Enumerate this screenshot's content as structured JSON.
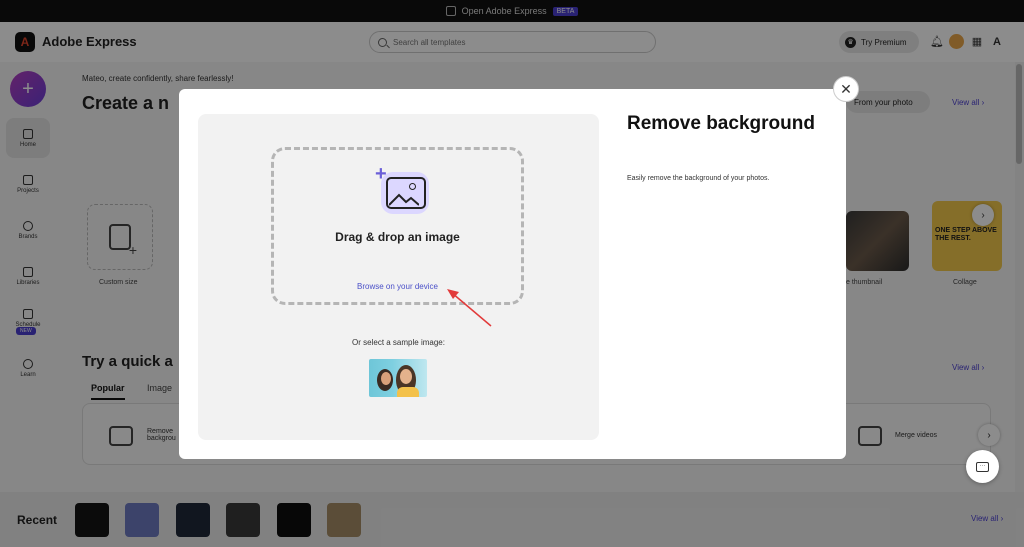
{
  "topbar": {
    "label": "Open Adobe Express",
    "badge": "BETA"
  },
  "header": {
    "app_name": "Adobe Express",
    "search_placeholder": "Search all templates",
    "premium_label": "Try Premium"
  },
  "rail": {
    "items": [
      {
        "label": "Home"
      },
      {
        "label": "Projects"
      },
      {
        "label": "Brands"
      },
      {
        "label": "Libraries"
      },
      {
        "label": "Schedule"
      },
      {
        "label": "Learn"
      }
    ],
    "new_badge": "NEW"
  },
  "page": {
    "greeting": "Mateo, create confidently, share fearlessly!",
    "create_title": "Create a n",
    "from_photo": "From your photo",
    "view_all": "View all",
    "custom_size": "Custom size",
    "thumbnail_label": "e thumbnail",
    "collage_label": "Collage",
    "collage_text": "ONE STEP ABOVE THE REST.",
    "quick_title": "Try a quick a",
    "tabs": [
      "Popular",
      "Image"
    ],
    "remove_bg_label": "Remove backgrou",
    "merge_videos": "Merge videos"
  },
  "recent": {
    "title": "Recent",
    "view_all": "View all"
  },
  "modal": {
    "title": "Remove background",
    "description": "Easily remove the background of your photos.",
    "drop_title": "Drag & drop an image",
    "browse_link": "Browse on your device",
    "sample_label": "Or select a sample image:",
    "close_symbol": "✕"
  },
  "colors": {
    "accent": "#4b3fd1",
    "link": "#4b50c8",
    "arrow": "#e23b3b"
  }
}
